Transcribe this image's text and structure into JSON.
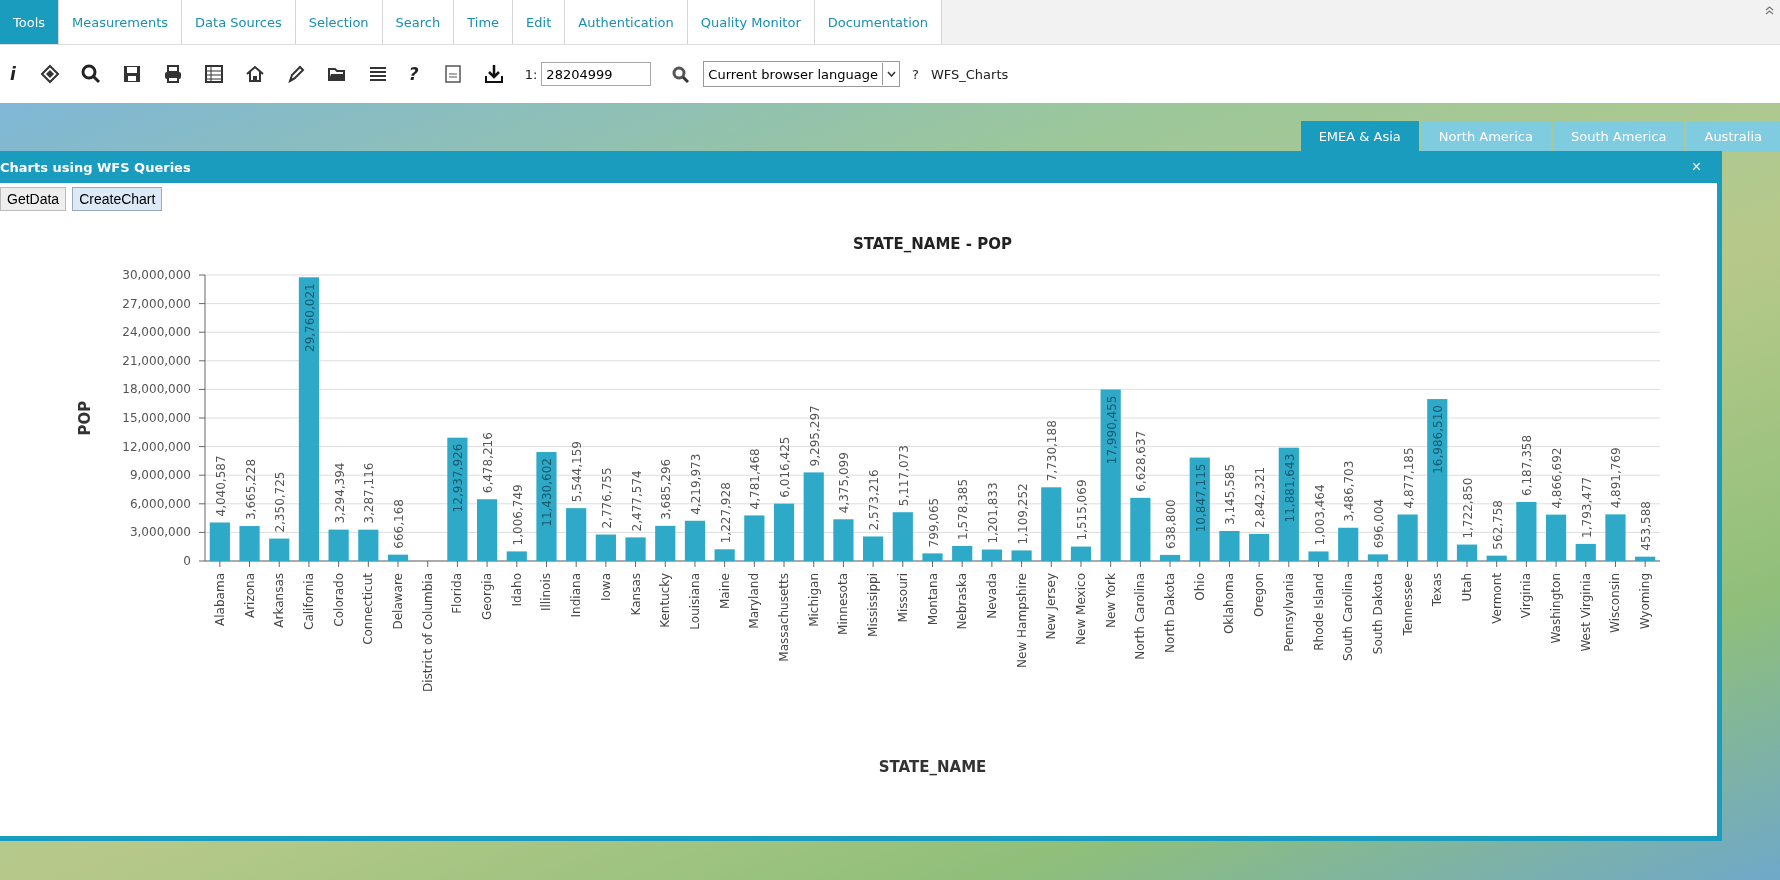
{
  "menu_tabs": [
    {
      "label": "Tools",
      "selected": true
    },
    {
      "label": "Measurements",
      "selected": false
    },
    {
      "label": "Data Sources",
      "selected": false
    },
    {
      "label": "Selection",
      "selected": false
    },
    {
      "label": "Search",
      "selected": false
    },
    {
      "label": "Time",
      "selected": false
    },
    {
      "label": "Edit",
      "selected": false
    },
    {
      "label": "Authentication",
      "selected": false
    },
    {
      "label": "Quality Monitor",
      "selected": false
    },
    {
      "label": "Documentation",
      "selected": false
    }
  ],
  "toolbar": {
    "icons": [
      {
        "kind": "text",
        "label": "i"
      },
      {
        "kind": "layers"
      },
      {
        "kind": "zoom"
      },
      {
        "kind": "save"
      },
      {
        "kind": "print"
      },
      {
        "kind": "table"
      },
      {
        "kind": "home"
      },
      {
        "kind": "pen"
      },
      {
        "kind": "folder"
      },
      {
        "kind": "wms"
      },
      {
        "kind": "text",
        "label": "?"
      },
      {
        "kind": "log"
      },
      {
        "kind": "download"
      }
    ],
    "scale": {
      "prefix": "1:",
      "value": "28204999"
    },
    "language": {
      "value": "Current browser language"
    },
    "help": "?",
    "project": "WFS_Charts"
  },
  "region_tabs": [
    {
      "label": "EMEA & Asia",
      "selected": true
    },
    {
      "label": "North America",
      "selected": false
    },
    {
      "label": "South America",
      "selected": false
    },
    {
      "label": "Australia",
      "selected": false
    }
  ],
  "chart_window": {
    "title": "Charts using WFS Queries",
    "close": "×",
    "buttons": [
      "GetData",
      "CreateChart"
    ],
    "chart_data": {
      "type": "bar",
      "title": "STATE_NAME - POP",
      "xlabel": "STATE_NAME",
      "ylabel": "POP",
      "ylim": [
        0,
        30000000
      ],
      "yticks": [
        {
          "value": 0,
          "label": "0"
        },
        {
          "value": 3000000,
          "label": "3,000,000"
        },
        {
          "value": 6000000,
          "label": "6,000,000"
        },
        {
          "value": 9000000,
          "label": "9,000,000"
        },
        {
          "value": 12000000,
          "label": "12,000,000"
        },
        {
          "value": 15000000,
          "label": "15,000,000"
        },
        {
          "value": 18000000,
          "label": "18,000,000"
        },
        {
          "value": 21000000,
          "label": "21,000,000"
        },
        {
          "value": 24000000,
          "label": "24,000,000"
        },
        {
          "value": 27000000,
          "label": "27,000,000"
        },
        {
          "value": 30000000,
          "label": "30,000,000"
        }
      ],
      "categories": [
        "Alabama",
        "Arizona",
        "Arkansas",
        "California",
        "Colorado",
        "Connecticut",
        "Delaware",
        "District of Columbia",
        "Florida",
        "Georgia",
        "Idaho",
        "Illinois",
        "Indiana",
        "Iowa",
        "Kansas",
        "Kentucky",
        "Louisiana",
        "Maine",
        "Maryland",
        "Massachusetts",
        "Michigan",
        "Minnesota",
        "Mississippi",
        "Missouri",
        "Montana",
        "Nebraska",
        "Nevada",
        "New Hampshire",
        "New Jersey",
        "New Mexico",
        "New York",
        "North Carolina",
        "North Dakota",
        "Ohio",
        "Oklahoma",
        "Oregon",
        "Pennsylvania",
        "Rhode Island",
        "South Carolina",
        "South Dakota",
        "Tennessee",
        "Texas",
        "Utah",
        "Vermont",
        "Virginia",
        "Washington",
        "West Virginia",
        "Wisconsin",
        "Wyoming"
      ],
      "grid": true,
      "value_labels": [
        "4,040,587",
        "3,665,228",
        "2,350,725",
        "29,760,021",
        "3,294,394",
        "3,287,116",
        "666,168",
        null,
        "12,937,926",
        "6,478,216",
        "1,006,749",
        "11,430,602",
        "5,544,159",
        "2,776,755",
        "2,477,574",
        "3,685,296",
        "4,219,973",
        "1,227,928",
        "4,781,468",
        "6,016,425",
        "9,295,297",
        "4,375,099",
        "2,573,216",
        "5,117,073",
        "799,065",
        "1,578,385",
        "1,201,833",
        "1,109,252",
        "7,730,188",
        "1,515,069",
        "17,990,455",
        "6,628,637",
        "638,800",
        "10,847,115",
        "3,145,585",
        "2,842,321",
        "11,881,643",
        "1,003,464",
        "3,486,703",
        "696,004",
        "4,877,185",
        "16,986,510",
        "1,722,850",
        "562,758",
        "6,187,358",
        "4,866,692",
        "1,793,477",
        "4,891,769",
        "453,588"
      ],
      "series": [
        {
          "color": "#2fa9c8",
          "values": [
            4040587,
            3665228,
            2350725,
            29760021,
            3294394,
            3287116,
            666168,
            null,
            12937926,
            6478216,
            1006749,
            11430602,
            5544159,
            2776755,
            2477574,
            3685296,
            4219973,
            1227928,
            4781468,
            6016425,
            9295297,
            4375099,
            2573216,
            5117073,
            799065,
            1578385,
            1201833,
            1109252,
            7730188,
            1515069,
            17990455,
            6628637,
            638800,
            10847115,
            3145585,
            2842321,
            11881643,
            1003464,
            3486703,
            696004,
            4877185,
            16986510,
            1722850,
            562758,
            6187358,
            4866692,
            1793477,
            4891769,
            453588
          ]
        }
      ]
    }
  }
}
